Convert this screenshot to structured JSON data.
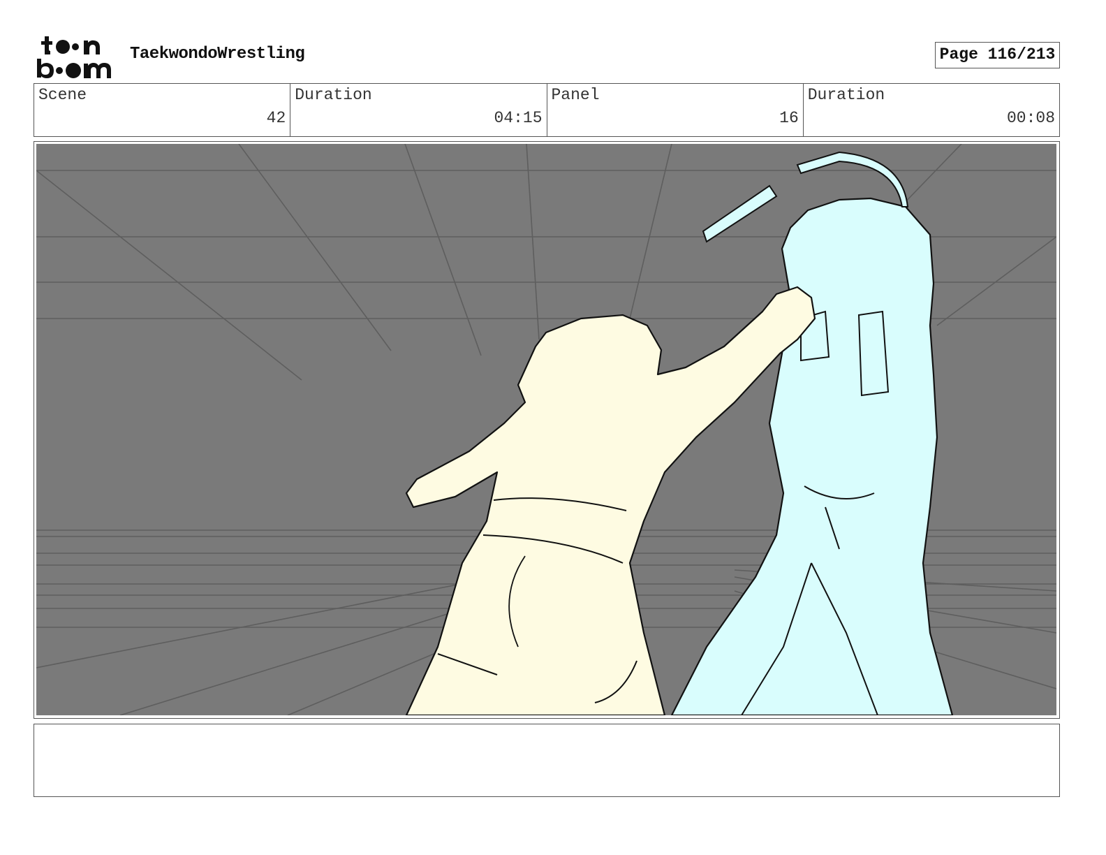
{
  "header": {
    "logo_text": "toon boom",
    "project_title": "TaekwondoWrestling",
    "page_label": "Page 116/213"
  },
  "info": {
    "scene_label": "Scene",
    "scene_value": "42",
    "scene_duration_label": "Duration",
    "scene_duration_value": "04:15",
    "panel_label": "Panel",
    "panel_value": "16",
    "panel_duration_label": "Duration",
    "panel_duration_value": "00:08"
  },
  "panel": {
    "background_color": "#7a7a7a",
    "left_figure_color": "#fefbe2",
    "right_figure_color": "#d9fdfd"
  },
  "notes": {
    "text": ""
  }
}
